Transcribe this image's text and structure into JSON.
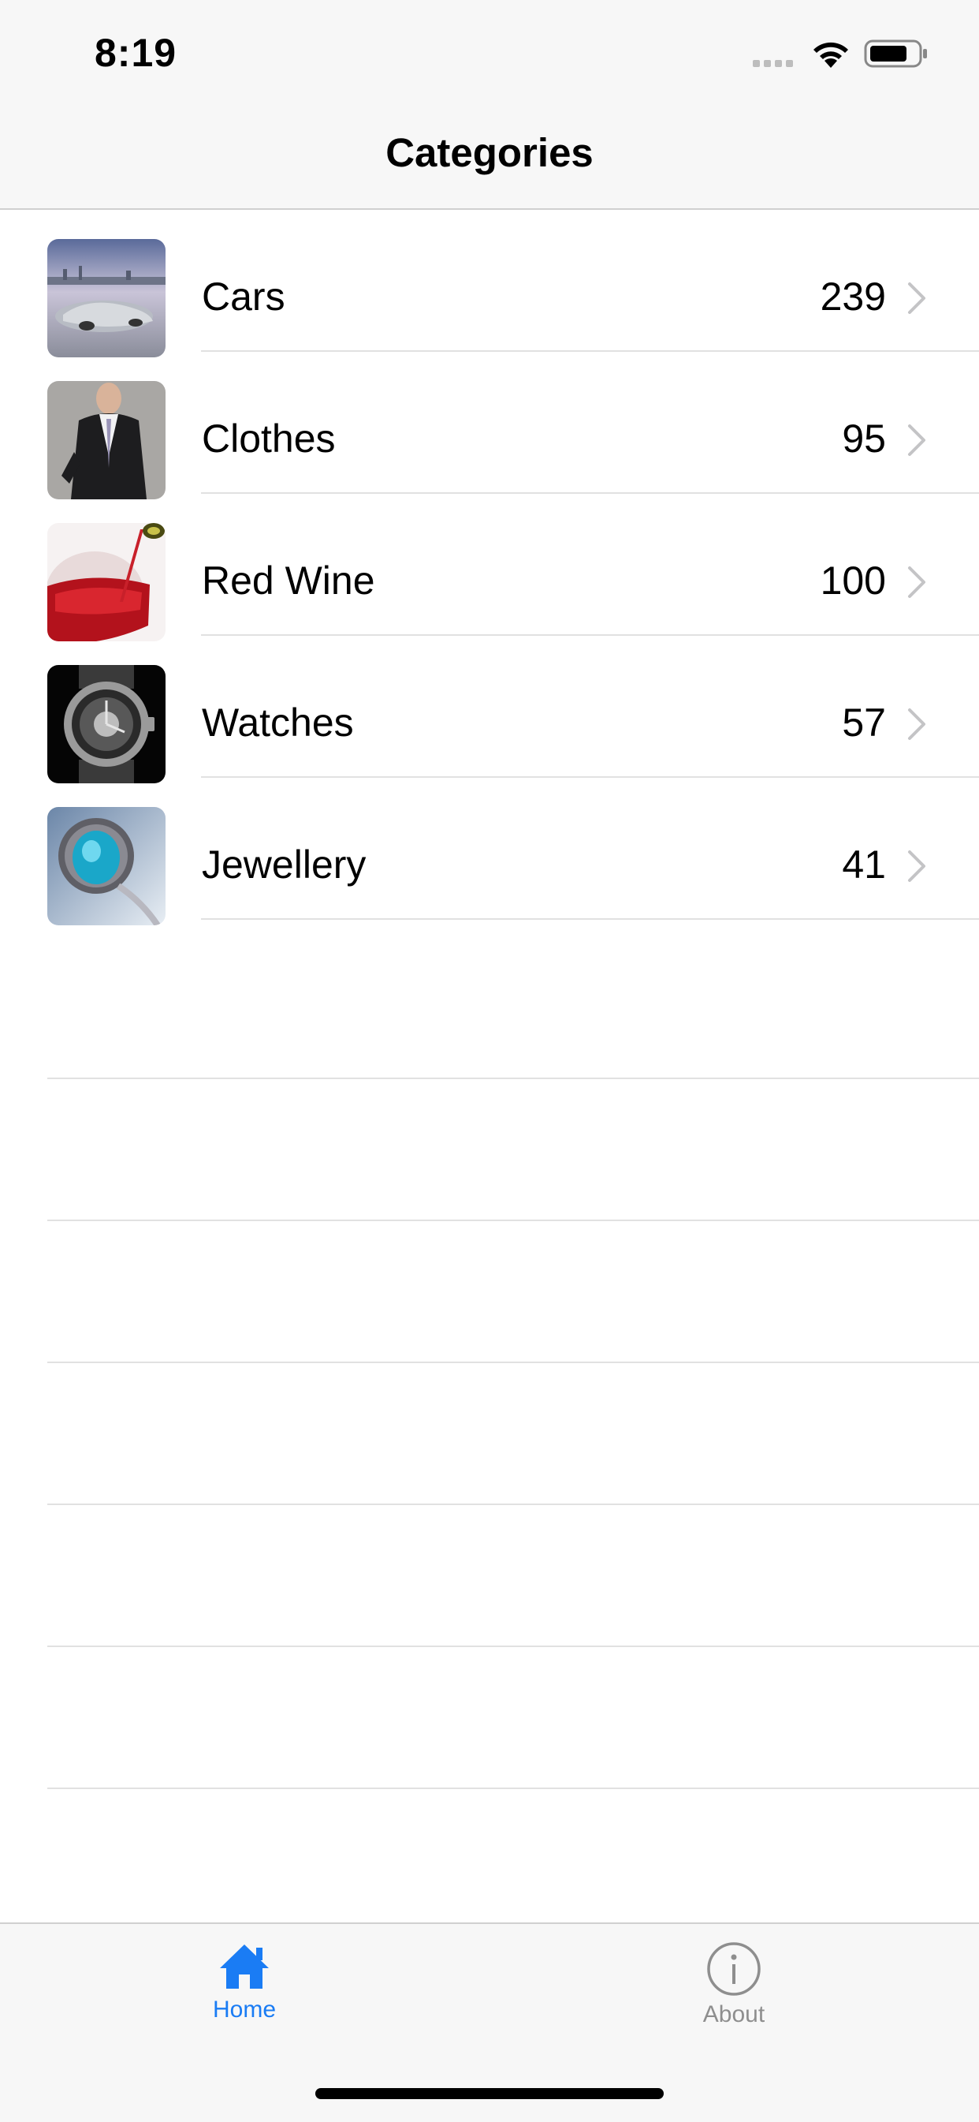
{
  "status_bar": {
    "time": "8:19"
  },
  "nav": {
    "title": "Categories"
  },
  "categories": [
    {
      "label": "Cars",
      "count": "239",
      "image": "car-thumbnail"
    },
    {
      "label": "Clothes",
      "count": "95",
      "image": "suit-thumbnail"
    },
    {
      "label": "Red Wine",
      "count": "100",
      "image": "wine-glass-thumbnail"
    },
    {
      "label": "Watches",
      "count": "57",
      "image": "watch-thumbnail"
    },
    {
      "label": "Jewellery",
      "count": "41",
      "image": "ring-thumbnail"
    }
  ],
  "tab_bar": {
    "home_label": "Home",
    "about_label": "About",
    "active_color": "#1a7cf4",
    "inactive_color": "#8e8e8e"
  }
}
